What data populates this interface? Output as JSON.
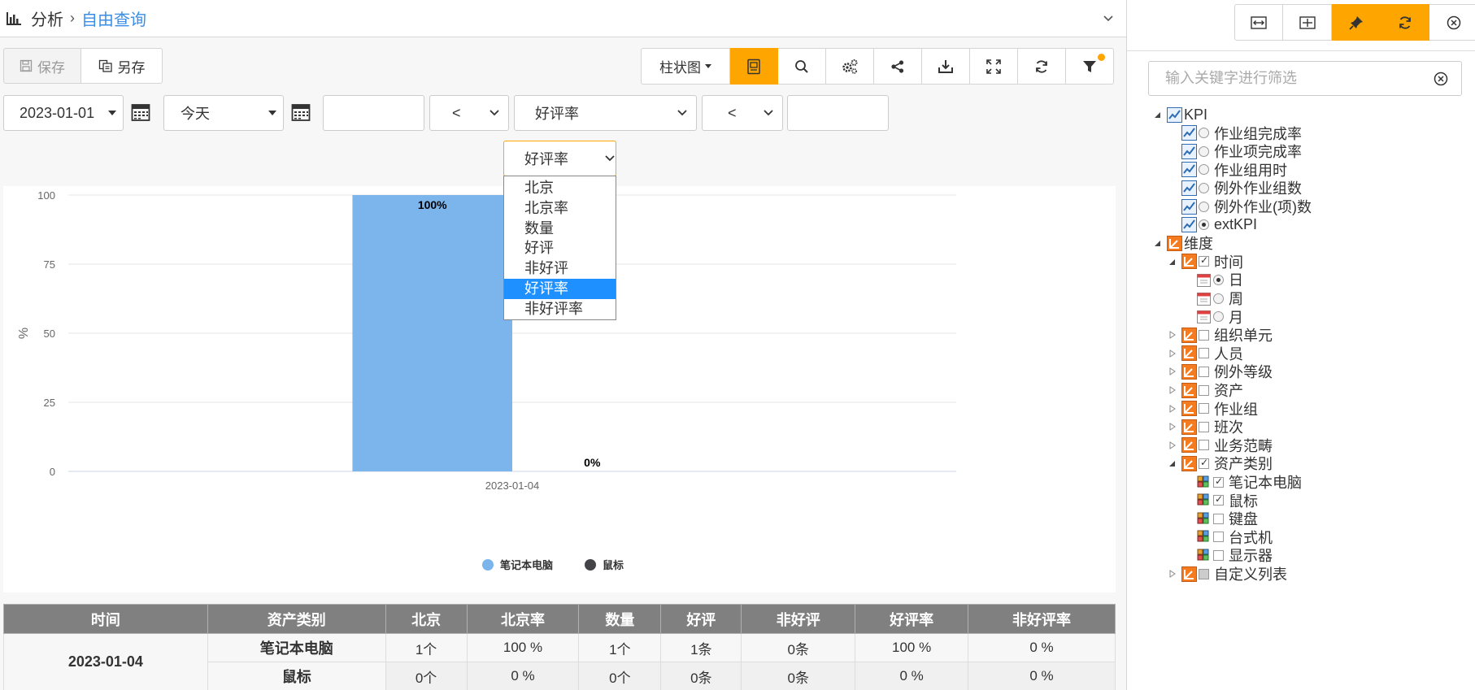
{
  "header": {
    "root": "分析",
    "current": "自由查询"
  },
  "actions": {
    "save": "保存",
    "save_as": "另存"
  },
  "toolbar": {
    "chart_type": "柱状图"
  },
  "filters": {
    "start_date": "2023-01-01",
    "end_date": "今天",
    "field3_value": "",
    "op1": "<",
    "metric": "好评率",
    "op2": "<",
    "field6_value": ""
  },
  "measure_select": {
    "selected": "好评率",
    "options": [
      "北京",
      "北京率",
      "数量",
      "好评",
      "非好评",
      "好评率",
      "非好评率"
    ]
  },
  "chart_data": {
    "type": "bar",
    "categories": [
      "2023-01-04"
    ],
    "series": [
      {
        "name": "笔记本电脑",
        "values": [
          100
        ],
        "color": "#7cb5ec",
        "label": "100%"
      },
      {
        "name": "鼠标",
        "values": [
          0
        ],
        "color": "#434348",
        "label": "0%"
      }
    ],
    "ylabel": "%",
    "ylim": [
      0,
      100
    ],
    "yticks": [
      "0",
      "25",
      "50",
      "75",
      "100"
    ],
    "grid": true,
    "legend": "bottom-center"
  },
  "table": {
    "headers": [
      "时间",
      "资产类别",
      "北京",
      "北京率",
      "数量",
      "好评",
      "非好评",
      "好评率",
      "非好评率"
    ],
    "group": "2023-01-04",
    "rows": [
      [
        "笔记本电脑",
        "1个",
        "100 %",
        "1个",
        "1条",
        "0条",
        "100 %",
        "0 %"
      ],
      [
        "鼠标",
        "0个",
        "0 %",
        "0个",
        "0条",
        "0条",
        "0 %",
        "0 %"
      ]
    ]
  },
  "side": {
    "filter_placeholder": "输入关键字进行筛选",
    "kpi_root": "KPI",
    "kpi_items": [
      "作业组完成率",
      "作业项完成率",
      "作业组用时",
      "例外作业组数",
      "例外作业(项)数",
      "extKPI"
    ],
    "dim_root": "维度",
    "time": {
      "label": "时间",
      "children": [
        "日",
        "周",
        "月"
      ]
    },
    "dims": [
      "组织单元",
      "人员",
      "例外等级",
      "资产",
      "作业组",
      "班次",
      "业务范畴"
    ],
    "asset_type": {
      "label": "资产类别",
      "children": [
        "笔记本电脑",
        "鼠标",
        "键盘",
        "台式机",
        "显示器"
      ]
    },
    "custom": "自定义列表"
  },
  "colors": {
    "accent": "#ffa500",
    "link": "#3a8ee6",
    "selected": "#1e90ff",
    "table_header": "#808080"
  }
}
